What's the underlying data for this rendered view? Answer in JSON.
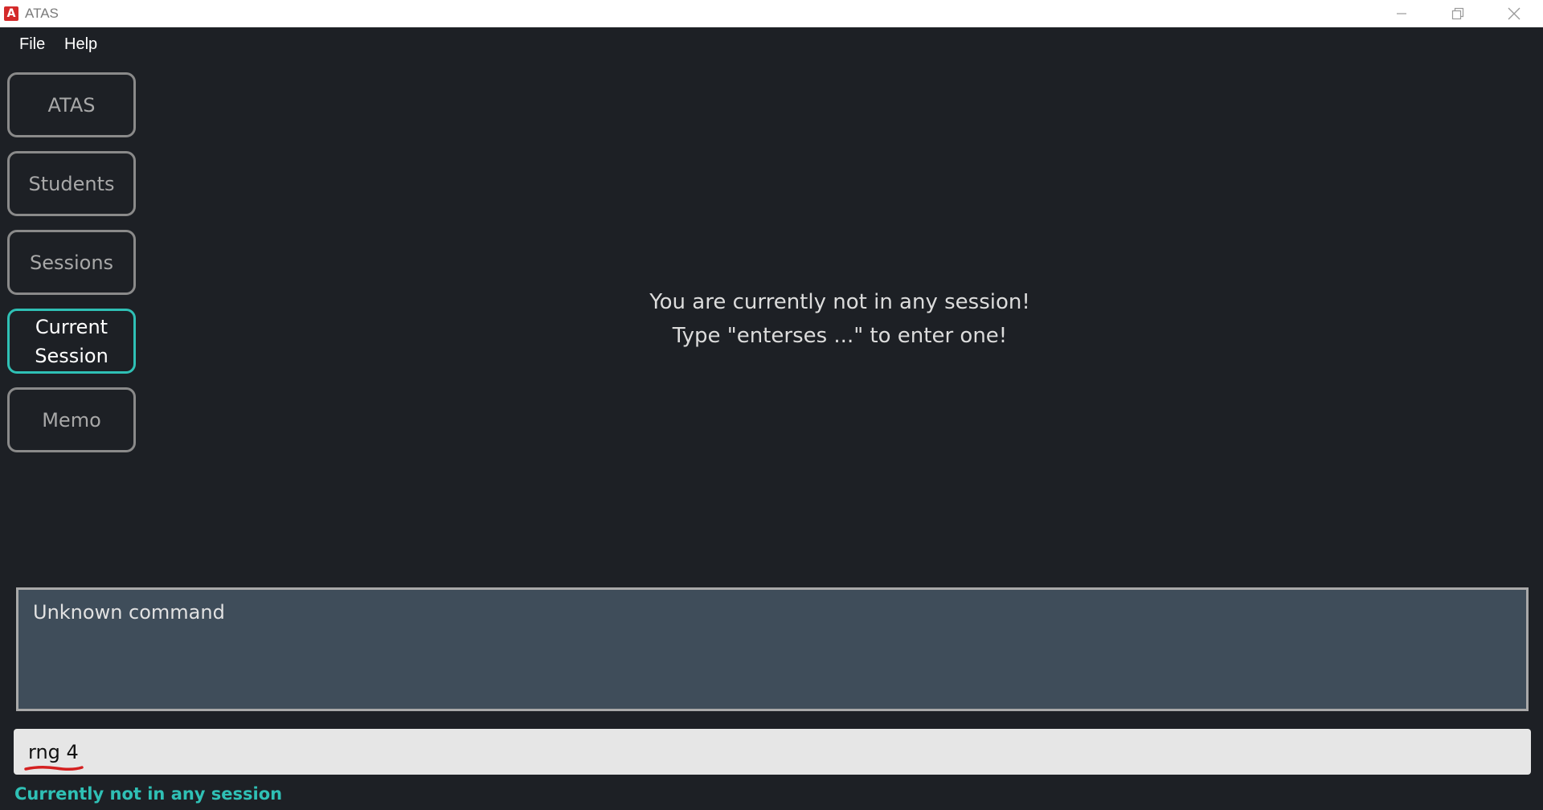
{
  "window": {
    "title": "ATAS",
    "app_icon_letter": "A",
    "controls": [
      "minimize-icon",
      "restore-icon",
      "close-icon"
    ]
  },
  "menu": {
    "file_label": "File",
    "help_label": "Help"
  },
  "nav": {
    "items": [
      {
        "label": "ATAS",
        "active": false
      },
      {
        "label": "Students",
        "active": false
      },
      {
        "label": "Sessions",
        "active": false
      },
      {
        "label": "Current Session",
        "active": true
      },
      {
        "label": "Memo",
        "active": false
      }
    ]
  },
  "main": {
    "message_line1": "You are currently not in any session!",
    "message_line2": "Type \"enterses ...\" to enter one!"
  },
  "result": {
    "text": "Unknown command"
  },
  "command": {
    "value": "rng 4"
  },
  "status": {
    "text": "Currently not in any session"
  },
  "colors": {
    "background": "#1d2025",
    "accent": "#2fc0b5",
    "result_box": "#3f4d5a",
    "underline": "#d42020"
  }
}
